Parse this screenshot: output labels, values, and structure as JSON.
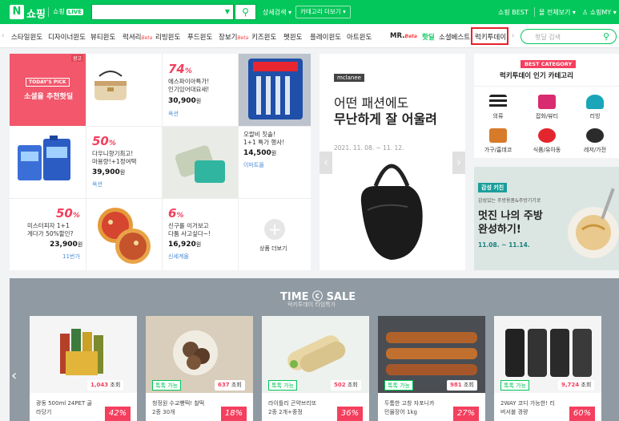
{
  "header": {
    "logo": "N",
    "brand": "쇼핑",
    "live": "쇼핑",
    "live_badge": "LIVE",
    "detail": "상세검색 ▾",
    "category_more": "카테고리 더보기 ▾",
    "shopping_best": "쇼핑 BEST",
    "all_services": "몰 전체보기 ▾",
    "my": "♙ 쇼핑MY ▾"
  },
  "nav": {
    "items": [
      "스타일윈도",
      "디자이너윈도",
      "뷰티윈도",
      "럭셔리",
      "리빙윈도",
      "푸드윈도",
      "장보기",
      "키즈윈도",
      "펫윈도",
      "플레이윈도",
      "아트윈도",
      "MR.",
      "핫딜",
      "소셜베스트",
      "럭키투데이"
    ],
    "beta": "Beta",
    "search_placeholder": "핫딜 검색"
  },
  "today": {
    "ad": "광고",
    "badge": "TODAY'S PICK",
    "title": "소셜을 추천핫딜"
  },
  "products": [
    {
      "pct": "74",
      "line1": "에스파이아특가!",
      "line2": "인기있어대요새!",
      "price": "30,900",
      "price_unit": "원",
      "sub": "옥션"
    },
    {
      "line1": "오랄비 칫솔!",
      "line2": "1+1 특가 행사!",
      "price": "14,500",
      "price_unit": "원",
      "sub": "이마트몰"
    },
    {
      "pct": "50",
      "line1": "다우니향기최고!",
      "line2": "마용량!+1정여택",
      "price": "39,900",
      "price_unit": "원",
      "sub": "옥션"
    },
    {
      "pct": "50",
      "line1": "미스터피자 1+1",
      "line2": "게다가 50%할인?",
      "price": "23,900",
      "price_unit": "원",
      "sub": "11번가"
    },
    {
      "pct": "6",
      "line1": "신구를 이거보고",
      "line2": "다툼 사고싶다~!",
      "price": "16,920",
      "price_unit": "원",
      "sub": "신세계몰"
    }
  ],
  "more_label": "상품 더보기",
  "banner": {
    "brand": "mclanee",
    "line1": "어떤 패션에도",
    "line2": "무난하게 잘 어울려",
    "date": "2021. 11. 08. ~ 11. 12."
  },
  "best": {
    "badge": "BEST CATEGORY",
    "title": "럭키투데이 인기 카테고리",
    "items": [
      "의류",
      "잡화/뷰티",
      "리빙",
      "가구/홈데코",
      "식품/유아동",
      "레저/가전"
    ]
  },
  "kitchen": {
    "tag": "감성 키친",
    "sub": "감성있는 주방용품&주방기기로",
    "line1": "멋진 나의 주방",
    "line2": "완성하기!",
    "date": "11.08. ~ 11.14."
  },
  "sale": {
    "title": "TIME ⓒ SALE",
    "sub": "럭키투데이 타임특가",
    "items": [
      {
        "count": "1,043",
        "suffix": "조회",
        "l1": "광동 500ml 24PET 골",
        "l2": "라당기",
        "pct": "42%"
      },
      {
        "badge": "톡톡 가능",
        "count": "637",
        "suffix": "조회",
        "l1": "청정원 수교빵떡! 찰떡",
        "l2": "2종 30개",
        "pct": "18%"
      },
      {
        "badge": "톡톡 가능",
        "count": "502",
        "suffix": "조회",
        "l1": "라이틀리 곤약브리또",
        "l2": "2종 2개+중정",
        "pct": "36%"
      },
      {
        "badge": "톡톡 가능",
        "count": "981",
        "suffix": "조회",
        "l1": "두툼한 고창 자포니카",
        "l2": "민물장어 1kg",
        "pct": "27%"
      },
      {
        "badge": "톡톡 가능",
        "count": "9,724",
        "suffix": "조회",
        "l1": "2WAY 코디 가능한! 리",
        "l2": "버서블 경량",
        "pct": "60%"
      }
    ]
  },
  "colors": {
    "brand": "#03c75a",
    "sale": "#f43f5e",
    "highlight": "#e8212d"
  }
}
